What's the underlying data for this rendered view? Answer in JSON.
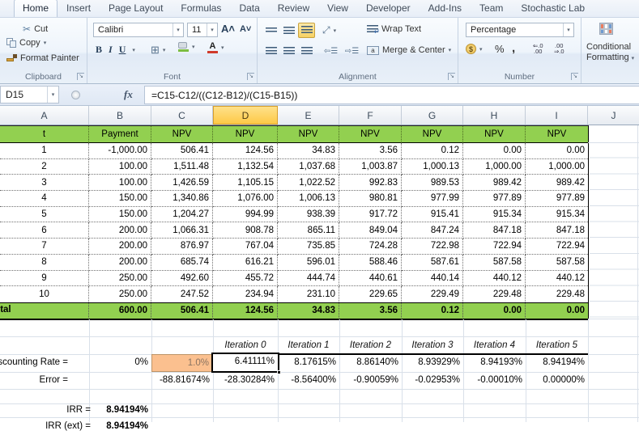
{
  "window": {
    "tabs": [
      "Home",
      "Insert",
      "Page Layout",
      "Formulas",
      "Data",
      "Review",
      "View",
      "Developer",
      "Add-Ins",
      "Team",
      "Stochastic Lab"
    ],
    "active_tab": "Home"
  },
  "ribbon": {
    "clipboard": {
      "label": "Clipboard",
      "cut": "Cut",
      "copy": "Copy",
      "format_painter": "Format Painter"
    },
    "font": {
      "label": "Font",
      "font_name": "Calibri",
      "font_size": "11",
      "bold": "B",
      "italic": "I",
      "underline": "U"
    },
    "alignment": {
      "label": "Alignment",
      "wrap_text": "Wrap Text",
      "merge_center": "Merge & Center"
    },
    "number": {
      "label": "Number",
      "format": "Percentage",
      "percent": "%",
      "comma": ","
    },
    "styles": {
      "conditional_formatting_line1": "Conditional",
      "conditional_formatting_line2": "Formatting"
    }
  },
  "formula_bar": {
    "name_box": "D15",
    "fx": "fx",
    "formula": "=C15-C12/((C12-B12)/(C15-B15))"
  },
  "columns": [
    "A",
    "B",
    "C",
    "D",
    "E",
    "F",
    "G",
    "H",
    "I",
    "J"
  ],
  "selected_column": "D",
  "table": {
    "headers": [
      "t",
      "Payment",
      "NPV",
      "NPV",
      "NPV",
      "NPV",
      "NPV",
      "NPV",
      "NPV"
    ],
    "rows": [
      [
        "1",
        "-1,000.00",
        "506.41",
        "124.56",
        "34.83",
        "3.56",
        "0.12",
        "0.00",
        "0.00"
      ],
      [
        "2",
        "100.00",
        "1,511.48",
        "1,132.54",
        "1,037.68",
        "1,003.87",
        "1,000.13",
        "1,000.00",
        "1,000.00"
      ],
      [
        "3",
        "100.00",
        "1,426.59",
        "1,105.15",
        "1,022.52",
        "992.83",
        "989.53",
        "989.42",
        "989.42"
      ],
      [
        "4",
        "150.00",
        "1,340.86",
        "1,076.00",
        "1,006.13",
        "980.81",
        "977.99",
        "977.89",
        "977.89"
      ],
      [
        "5",
        "150.00",
        "1,204.27",
        "994.99",
        "938.39",
        "917.72",
        "915.41",
        "915.34",
        "915.34"
      ],
      [
        "6",
        "200.00",
        "1,066.31",
        "908.78",
        "865.11",
        "849.04",
        "847.24",
        "847.18",
        "847.18"
      ],
      [
        "7",
        "200.00",
        "876.97",
        "767.04",
        "735.85",
        "724.28",
        "722.98",
        "722.94",
        "722.94"
      ],
      [
        "8",
        "200.00",
        "685.74",
        "616.21",
        "596.01",
        "588.46",
        "587.61",
        "587.58",
        "587.58"
      ],
      [
        "9",
        "250.00",
        "492.60",
        "455.72",
        "444.74",
        "440.61",
        "440.14",
        "440.12",
        "440.12"
      ],
      [
        "10",
        "250.00",
        "247.52",
        "234.94",
        "231.10",
        "229.65",
        "229.49",
        "229.48",
        "229.48"
      ]
    ],
    "total": {
      "label": "Total",
      "values": [
        "600.00",
        "506.41",
        "124.56",
        "34.83",
        "3.56",
        "0.12",
        "0.00",
        "0.00"
      ]
    }
  },
  "iterations": {
    "headers": [
      "Iteration 0",
      "Iteration 1",
      "Iteration 2",
      "Iteration 3",
      "Iteration 4",
      "Iteration 5"
    ],
    "rate_label": "Discounting Rate =",
    "rate_initial": "0%",
    "rate_c": "1.0%",
    "rate_d": "6.41111%",
    "rate_rest": [
      "8.17615%",
      "8.86140%",
      "8.93929%",
      "8.94193%",
      "8.94194%"
    ],
    "error_label": "Error =",
    "errors": [
      "-88.81674%",
      "-28.30284%",
      "-8.56400%",
      "-0.90059%",
      "-0.02953%",
      "-0.00010%",
      "0.00000%"
    ],
    "irr_label": "IRR =",
    "irr_value": "8.94194%",
    "irr_ext_label": "IRR (ext) =",
    "irr_ext_value": "8.94194%"
  },
  "colors": {
    "table_green": "#92D050",
    "input_cell_orange": "#FBC08F",
    "selected_header": "#FFD25F",
    "selection_border": "#000000"
  }
}
